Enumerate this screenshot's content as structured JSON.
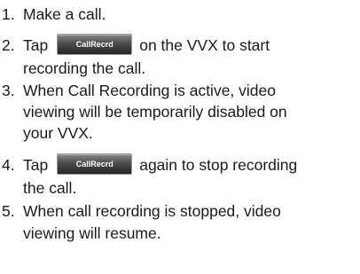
{
  "steps": [
    {
      "number": "1.",
      "lines": [
        "Make a call."
      ]
    },
    {
      "number": "2.",
      "before": "Tap",
      "softkey": "CallRecrd",
      "after": "on the VVX to start",
      "lines": [
        "recording the call."
      ]
    },
    {
      "number": "3.",
      "lines": [
        "When Call Recording is active, video",
        "viewing will be temporarily disabled on",
        "your VVX."
      ]
    },
    {
      "number": "4.",
      "before": "Tap",
      "softkey": "CallRecrd",
      "after": "again to stop recording",
      "lines": [
        "the call."
      ]
    },
    {
      "number": "5.",
      "lines": [
        "When call recording is stopped, video",
        "viewing will resume."
      ]
    }
  ]
}
